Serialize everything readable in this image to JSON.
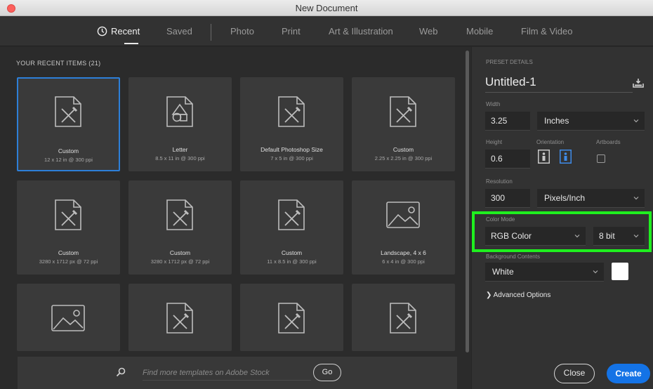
{
  "window": {
    "title": "New Document"
  },
  "tabs": [
    {
      "label": "Recent",
      "active": true,
      "icon": "clock-icon"
    },
    {
      "label": "Saved"
    },
    {
      "label": "Photo"
    },
    {
      "label": "Print"
    },
    {
      "label": "Art & Illustration"
    },
    {
      "label": "Web"
    },
    {
      "label": "Mobile"
    },
    {
      "label": "Film & Video"
    }
  ],
  "recent": {
    "header": "YOUR RECENT ITEMS",
    "count": "(21)",
    "items": [
      {
        "name": "Custom",
        "size": "12 x 12 in @ 300 ppi",
        "icon": "document-brush-icon",
        "selected": true
      },
      {
        "name": "Letter",
        "size": "8.5 x 11 in @ 300 ppi",
        "icon": "document-shapes-icon"
      },
      {
        "name": "Default Photoshop Size",
        "size": "7 x 5 in @ 300 ppi",
        "icon": "document-brush-icon"
      },
      {
        "name": "Custom",
        "size": "2.25 x 2.25 in @ 300 ppi",
        "icon": "document-brush-icon"
      },
      {
        "name": "Custom",
        "size": "3280 x 1712 px @ 72 ppi",
        "icon": "document-brush-icon"
      },
      {
        "name": "Custom",
        "size": "3280 x 1712 px @ 72 ppi",
        "icon": "document-brush-icon"
      },
      {
        "name": "Custom",
        "size": "11 x 8.5 in @ 300 ppi",
        "icon": "document-brush-icon"
      },
      {
        "name": "Landscape, 4 x 6",
        "size": "6 x 4 in @ 300 ppi",
        "icon": "image-landscape-icon"
      },
      {
        "name": "",
        "size": "",
        "icon": "image-landscape-icon"
      },
      {
        "name": "",
        "size": "",
        "icon": "document-brush-icon"
      },
      {
        "name": "",
        "size": "",
        "icon": "document-brush-icon"
      },
      {
        "name": "",
        "size": "",
        "icon": "document-brush-icon"
      }
    ]
  },
  "search": {
    "placeholder": "Find more templates on Adobe Stock",
    "go_label": "Go"
  },
  "preset": {
    "section_label": "PRESET DETAILS",
    "name": "Untitled-1",
    "width_label": "Width",
    "width_value": "3.25",
    "width_unit": "Inches",
    "height_label": "Height",
    "height_value": "0.6",
    "orientation_label": "Orientation",
    "artboards_label": "Artboards",
    "resolution_label": "Resolution",
    "resolution_value": "300",
    "resolution_unit": "Pixels/Inch",
    "color_mode_label": "Color Mode",
    "color_mode_value": "RGB Color",
    "bit_depth_value": "8 bit",
    "background_label": "Background Contents",
    "background_value": "White",
    "background_swatch": "#ffffff",
    "advanced_label": "Advanced Options",
    "close_label": "Close",
    "create_label": "Create"
  },
  "colors": {
    "accent": "#1473e6",
    "selection": "#2d7fd8",
    "highlight": "#1ff01f"
  }
}
